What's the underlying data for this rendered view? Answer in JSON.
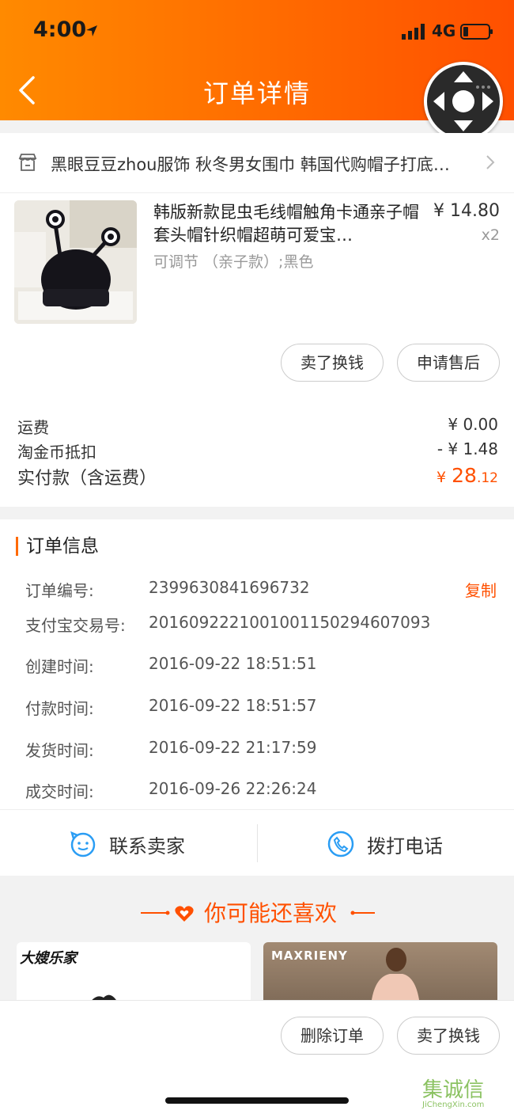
{
  "status_bar": {
    "time": "4:00",
    "network": "4G"
  },
  "header": {
    "title": "订单详情"
  },
  "shop": {
    "text": "黑眼豆豆zhou服饰  秋冬男女围巾 韩国代购帽子打底…"
  },
  "product": {
    "title": "韩版新款昆虫毛线帽触角卡通亲子帽 套头帽针织帽超萌可爱宝…",
    "sku": "可调节 （亲子款）;黑色",
    "price": "¥ 14.80",
    "quantity": "x2",
    "buttons": [
      "卖了换钱",
      "申请售后"
    ]
  },
  "fees": {
    "shipping_label": "运费",
    "shipping_value": "¥ 0.00",
    "coins_label": "淘金币抵扣",
    "coins_value": "- ¥ 1.48",
    "paid_label": "实付款（含运费）",
    "paid_symbol": "¥",
    "paid_int": "28",
    "paid_dec": ".12"
  },
  "order_info": {
    "heading": "订单信息",
    "copy_label": "复制",
    "rows": [
      {
        "label": "订单编号:",
        "value": "2399630841696732"
      },
      {
        "label": "支付宝交易号:",
        "value": "2016092221001001150294607093"
      },
      {
        "label": "创建时间:",
        "value": "2016-09-22 18:51:51"
      },
      {
        "label": "付款时间:",
        "value": "2016-09-22 18:51:57"
      },
      {
        "label": "发货时间:",
        "value": "2016-09-22 21:17:59"
      },
      {
        "label": "成交时间:",
        "value": "2016-09-26 22:26:24"
      }
    ]
  },
  "contact": {
    "seller": "联系卖家",
    "phone": "拨打电话"
  },
  "recommend": {
    "title": "你可能还喜欢",
    "cards": [
      {
        "brand": "大嫂乐家"
      },
      {
        "brand": "MAXRIENY"
      }
    ]
  },
  "bottom": {
    "buttons": [
      "删除订单",
      "卖了换钱"
    ]
  },
  "watermark": {
    "text": "集诚信",
    "sub": "JiChengXin.com"
  },
  "colors": {
    "accent": "#ff5000",
    "header_start": "#ff8a00",
    "header_end": "#ff5000"
  }
}
